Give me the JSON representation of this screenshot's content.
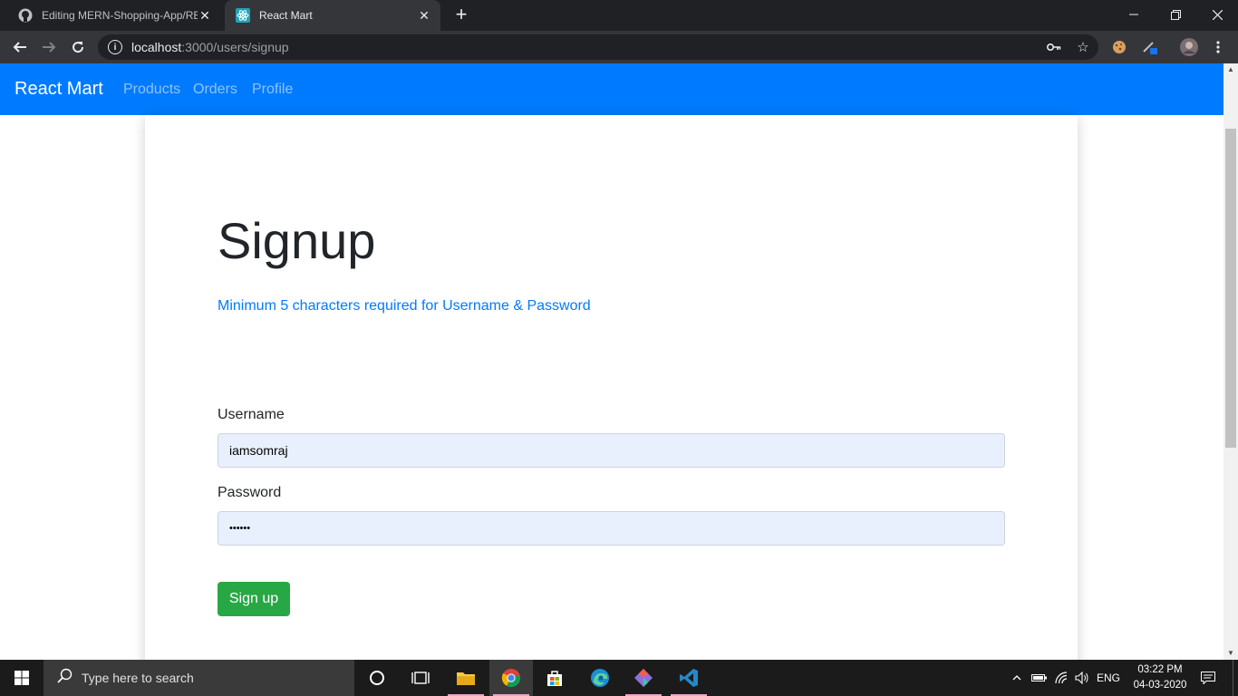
{
  "browser": {
    "tabs": [
      {
        "title": "Editing MERN-Shopping-App/RE",
        "icon": "github-icon",
        "active": false
      },
      {
        "title": "React Mart",
        "icon": "react-icon",
        "active": true
      }
    ],
    "url_host": "localhost",
    "url_path": ":3000/users/signup"
  },
  "navbar": {
    "brand": "React Mart",
    "links": [
      "Products",
      "Orders",
      "Profile"
    ],
    "color": "#007bff"
  },
  "form": {
    "heading": "Signup",
    "hint": "Minimum 5 characters required for Username & Password",
    "username_label": "Username",
    "username_value": "iamsomraj",
    "password_label": "Password",
    "password_value": "••••••",
    "submit_label": "Sign up",
    "submit_color": "#28a745"
  },
  "taskbar": {
    "search_placeholder": "Type here to search",
    "language": "ENG",
    "time": "03:22 PM",
    "date": "04-03-2020"
  }
}
